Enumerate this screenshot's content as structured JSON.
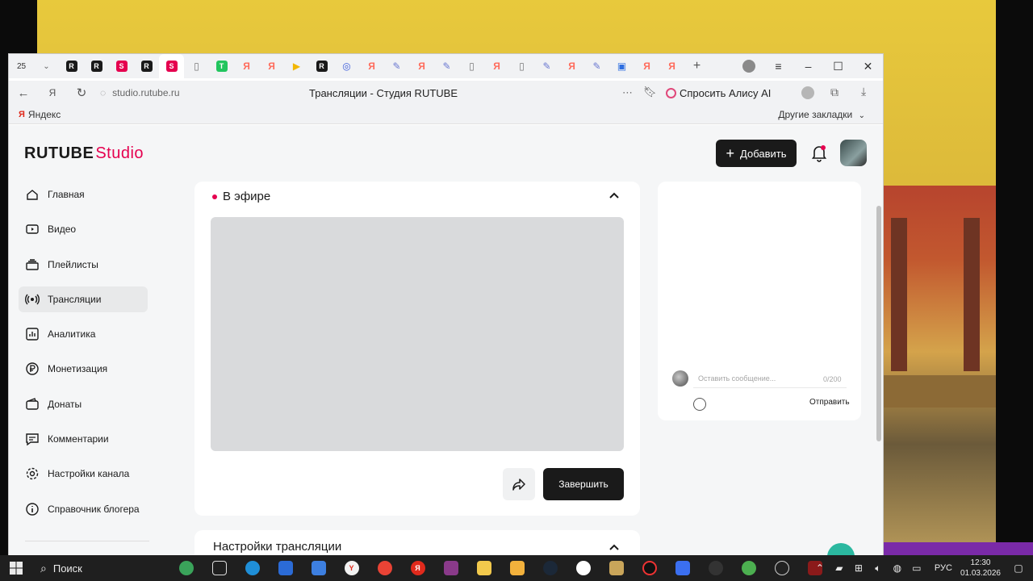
{
  "browser": {
    "tab_counter": "25",
    "url": "studio.rutube.ru",
    "page_title": "Трансляции - Студия RUTUBE",
    "alice_label": "Спросить Алису AI",
    "bookmarks": {
      "yandex": "Яндекс",
      "other": "Другие закладки"
    },
    "tab_icons": [
      {
        "icon": "rutube-icon",
        "glyph": "R",
        "color": "#1a1a1a"
      },
      {
        "icon": "rutube-icon",
        "glyph": "R",
        "color": "#1a1a1a"
      },
      {
        "icon": "studio-icon",
        "glyph": "S",
        "color": "#e5004f"
      },
      {
        "icon": "rutube-icon",
        "glyph": "R",
        "color": "#1a1a1a"
      },
      {
        "icon": "studio-icon",
        "glyph": "S",
        "color": "#e5004f"
      },
      {
        "icon": "doc-icon",
        "glyph": "▯",
        "color": "#777777"
      },
      {
        "icon": "sheets-icon",
        "glyph": "T",
        "color": "#22c55e"
      },
      {
        "icon": "yandex-icon",
        "glyph": "Я",
        "color": "#ff6b5b"
      },
      {
        "icon": "yandex-icon",
        "glyph": "Я",
        "color": "#ff6b5b"
      },
      {
        "icon": "play-icon",
        "glyph": "▶",
        "color": "#f2b705"
      },
      {
        "icon": "rutube-icon",
        "glyph": "R",
        "color": "#1a1a1a"
      },
      {
        "icon": "circle-icon",
        "glyph": "◎",
        "color": "#3b5bdb"
      },
      {
        "icon": "yandex-icon",
        "glyph": "Я",
        "color": "#ff6b5b"
      },
      {
        "icon": "pen-icon",
        "glyph": "✎",
        "color": "#6a78d0"
      },
      {
        "icon": "yandex-icon",
        "glyph": "Я",
        "color": "#ff6b5b"
      },
      {
        "icon": "pen-icon",
        "glyph": "✎",
        "color": "#6a78d0"
      },
      {
        "icon": "doc-icon",
        "glyph": "▯",
        "color": "#777777"
      },
      {
        "icon": "yandex-icon",
        "glyph": "Я",
        "color": "#ff6b5b"
      },
      {
        "icon": "doc-icon",
        "glyph": "▯",
        "color": "#777777"
      },
      {
        "icon": "pen-icon",
        "glyph": "✎",
        "color": "#6a78d0"
      },
      {
        "icon": "yandex-icon",
        "glyph": "Я",
        "color": "#ff6b5b"
      },
      {
        "icon": "pen-icon",
        "glyph": "✎",
        "color": "#6a78d0"
      },
      {
        "icon": "box-icon",
        "glyph": "▣",
        "color": "#2f6fe0"
      },
      {
        "icon": "yandex-icon",
        "glyph": "Я",
        "color": "#ff6b5b"
      },
      {
        "icon": "yandex-icon",
        "glyph": "Я",
        "color": "#ff6b5b"
      }
    ]
  },
  "site": {
    "logo_main": "RUTUBE",
    "logo_sub": "Studio",
    "add_button": "Добавить",
    "accent": "#e5004f"
  },
  "sidebar": {
    "items": [
      {
        "label": "Главная",
        "icon": "home-icon",
        "active": false
      },
      {
        "label": "Видео",
        "icon": "video-icon",
        "active": false
      },
      {
        "label": "Плейлисты",
        "icon": "playlist-icon",
        "active": false
      },
      {
        "label": "Трансляции",
        "icon": "broadcast-icon",
        "active": true
      },
      {
        "label": "Аналитика",
        "icon": "analytics-icon",
        "active": false
      },
      {
        "label": "Монетизация",
        "icon": "ruble-icon",
        "active": false
      },
      {
        "label": "Донаты",
        "icon": "wallet-icon",
        "active": false
      },
      {
        "label": "Комментарии",
        "icon": "comment-icon",
        "active": false
      },
      {
        "label": "Настройки канала",
        "icon": "gear-icon",
        "active": false
      },
      {
        "label": "Справочник блогера",
        "icon": "info-icon",
        "active": false
      }
    ]
  },
  "live": {
    "heading": "В эфире",
    "finish_button": "Завершить"
  },
  "chat": {
    "placeholder": "Оставить сообщение...",
    "counter": "0/200",
    "send_button": "Отправить"
  },
  "settings": {
    "title": "Настройки трансляции"
  },
  "taskbar": {
    "search_label": "Поиск",
    "language": "РУС",
    "time": "12:30",
    "date": "01.03.2026"
  }
}
